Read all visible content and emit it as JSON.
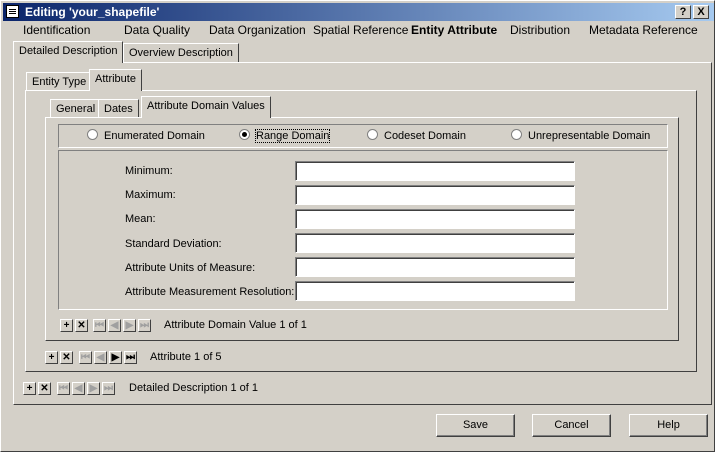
{
  "window": {
    "title": "Editing 'your_shapefile'",
    "help_btn": "?",
    "close_btn": "X"
  },
  "top_tabs": [
    "Identification",
    "Data Quality",
    "Data Organization",
    "Spatial Reference",
    "Entity Attribute",
    "Distribution",
    "Metadata Reference"
  ],
  "top_tab_active": "Entity Attribute",
  "sub_tabs": [
    "Detailed Description",
    "Overview Description"
  ],
  "entity_tabs": [
    "Entity Type",
    "Attribute"
  ],
  "attribute_tabs": [
    "General",
    "Dates",
    "Attribute Domain Values"
  ],
  "domain_options": [
    "Enumerated Domain",
    "Range Domain",
    "Codeset Domain",
    "Unrepresentable Domain"
  ],
  "domain_selected": "Range Domain",
  "fields": [
    {
      "label": "Minimum:",
      "value": ""
    },
    {
      "label": "Maximum:",
      "value": ""
    },
    {
      "label": "Mean:",
      "value": ""
    },
    {
      "label": "Standard Deviation:",
      "value": ""
    },
    {
      "label": "Attribute Units of Measure:",
      "value": ""
    },
    {
      "label": "Attribute Measurement Resolution:",
      "value": ""
    }
  ],
  "nav": {
    "domain_value": "Attribute Domain Value 1 of 1",
    "attribute": "Attribute 1 of 5",
    "detailed": "Detailed Description 1 of 1"
  },
  "buttons": {
    "save": "Save",
    "cancel": "Cancel",
    "help": "Help"
  }
}
